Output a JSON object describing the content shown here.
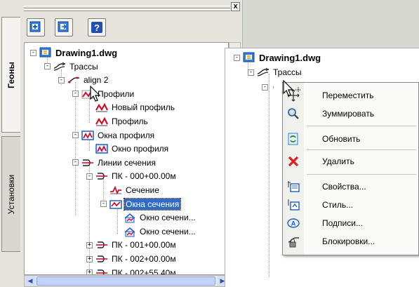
{
  "left_panel": {
    "close_label": "x",
    "tabs": [
      "Геоны",
      "Установки"
    ],
    "toolbar": [
      "add-icon",
      "nav-icon",
      "help-icon"
    ],
    "tree": [
      {
        "label": "Drawing1.dwg",
        "bold": true,
        "exp": "-",
        "icon": "drawing-icon"
      },
      {
        "label": "Трассы",
        "exp": "-",
        "icon": "alignments-icon"
      },
      {
        "label": "align 2",
        "exp": "-",
        "icon": "alignment-icon"
      },
      {
        "label": "Профили",
        "exp": "-",
        "icon": "profiles-icon"
      },
      {
        "label": "Новый профиль",
        "icon": "profile-icon"
      },
      {
        "label": "Профиль",
        "icon": "profile-icon"
      },
      {
        "label": "Окна профиля",
        "exp": "-",
        "icon": "profile-views-icon"
      },
      {
        "label": "Окно профиля",
        "icon": "profile-view-icon"
      },
      {
        "label": "Линии сечения",
        "exp": "-",
        "icon": "sample-lines-icon"
      },
      {
        "label": "ПК - 000+00.00м",
        "exp": "-",
        "icon": "sample-line-icon"
      },
      {
        "label": "Сечение",
        "icon": "section-icon"
      },
      {
        "label": "Окна сечения",
        "exp": "-",
        "icon": "section-views-icon",
        "selected": true
      },
      {
        "label": "Окно сечени...",
        "icon": "section-view-icon"
      },
      {
        "label": "Окно сечени...",
        "icon": "section-view-icon"
      },
      {
        "label": "ПК - 001+00.00м",
        "exp": "+",
        "icon": "sample-line-icon"
      },
      {
        "label": "ПК - 002+00.00м",
        "exp": "+",
        "icon": "sample-line-icon"
      },
      {
        "label": "ПК - 002+55.40м",
        "exp": "+",
        "icon": "sample-line-icon"
      }
    ]
  },
  "right_panel": {
    "tree": [
      {
        "label": "Drawing1.dwg",
        "bold": true,
        "exp": "-"
      },
      {
        "label": "Трассы",
        "exp": "-"
      }
    ]
  },
  "context_menu": {
    "items": [
      {
        "label": "Переместить",
        "icon": "move-icon"
      },
      {
        "label": "Зуммировать",
        "icon": "zoom-icon"
      },
      {
        "label": "Обновить",
        "icon": "refresh-icon"
      },
      {
        "label": "Удалить",
        "icon": "delete-icon"
      },
      {
        "label": "Свойства...",
        "icon": "properties-icon"
      },
      {
        "label": "Стиль...",
        "icon": "style-icon"
      },
      {
        "label": "Подписи...",
        "icon": "labels-icon"
      },
      {
        "label": "Блокировки...",
        "icon": "locks-icon"
      }
    ]
  },
  "colors": {
    "selection": "#316ac5",
    "delete": "#e02020",
    "icon_red": "#c8102e",
    "icon_blue": "#1f5fbf"
  }
}
